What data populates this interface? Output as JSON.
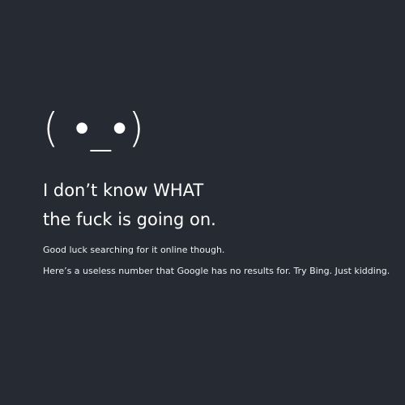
{
  "error": {
    "face": "( •_•)",
    "headline_line1": "I don’t know WHAT",
    "headline_line2": "the fuck is going on.",
    "detail_line1": "Good luck searching for it online though.",
    "detail_line2": "Here’s a useless number that Google has no results for. Try Bing. Just kidding."
  },
  "colors": {
    "background": "#262a33",
    "text": "#ffffff"
  }
}
